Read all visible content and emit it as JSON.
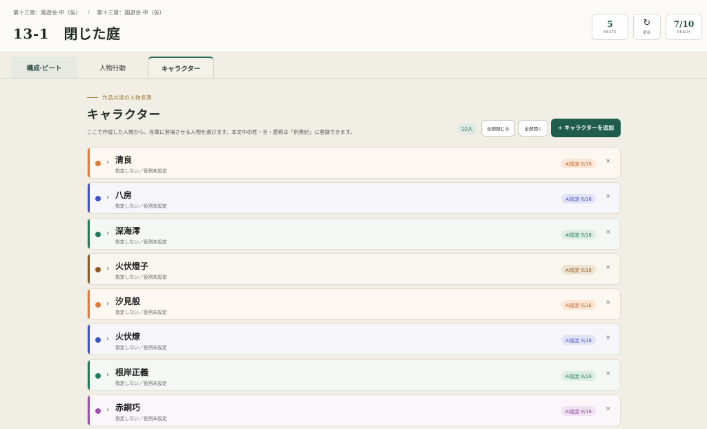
{
  "header": {
    "breadcrumb": [
      "第十三章：園遊会·中（仮）",
      "/",
      "第十三章：園遊会·中（仮）"
    ],
    "title_number": "13-1",
    "title_text": "閉じた庭",
    "stats": {
      "beats_value": "5",
      "beats_label": "BEATS",
      "update_icon": "↻",
      "update_label": "更新",
      "ready_value": "7/10",
      "ready_label": "READY"
    }
  },
  "tabs": [
    {
      "label": "構成·ビート"
    },
    {
      "label": "人物行動"
    },
    {
      "label": "キャラクター"
    }
  ],
  "section": {
    "eyebrow": "作品共通の人物名簿",
    "title": "キャラクター",
    "description": "ここで作成した人物から、各章に登場させる人物を選びます。本文中の姓・名・愛称は「別表記」に登録できます。",
    "count": "10人",
    "collapse_all": "全部閉じる",
    "expand_all": "全部開く",
    "add_label": "+ キャラクターを追加"
  },
  "characters": [
    {
      "name": "清良",
      "sub": "指定しない／役割未設定",
      "ai": "AI設定 0/16",
      "color": "#e07b39",
      "bg": "#fdf7f1",
      "ai_bg": "#fbe6d6",
      "ai_fg": "#c35f1f"
    },
    {
      "name": "八房",
      "sub": "指定しない／役割未設定",
      "ai": "AI設定 0/16",
      "color": "#3f4fc4",
      "bg": "#f6f6fa",
      "ai_bg": "#e2e4f6",
      "ai_fg": "#3f4fc4"
    },
    {
      "name": "深海澪",
      "sub": "指定しない／役割未設定",
      "ai": "AI設定 0/16",
      "color": "#1f7a5c",
      "bg": "#f3f8f5",
      "ai_bg": "#dcede5",
      "ai_fg": "#1f7a5c"
    },
    {
      "name": "火伏燈子",
      "sub": "指定しない／役割未設定",
      "ai": "AI設定 0/16",
      "color": "#8a5a20",
      "bg": "#f9f6f0",
      "ai_bg": "#efe4d2",
      "ai_fg": "#8a5a20"
    },
    {
      "name": "汐見般",
      "sub": "指定しない／役割未設定",
      "ai": "AI設定 0/16",
      "color": "#e07b39",
      "bg": "#fdf7f1",
      "ai_bg": "#fbe6d6",
      "ai_fg": "#c35f1f"
    },
    {
      "name": "火伏燎",
      "sub": "指定しない／役割未設定",
      "ai": "AI設定 0/16",
      "color": "#3f4fc4",
      "bg": "#f6f6fa",
      "ai_bg": "#e2e4f6",
      "ai_fg": "#3f4fc4"
    },
    {
      "name": "根岸正義",
      "sub": "指定しない／役割未設定",
      "ai": "AI設定 0/16",
      "color": "#1f7a5c",
      "bg": "#f3f8f5",
      "ai_bg": "#dcede5",
      "ai_fg": "#1f7a5c"
    },
    {
      "name": "赤銅巧",
      "sub": "指定しない／役割未設定",
      "ai": "AI設定 0/16",
      "color": "#9c4fae",
      "bg": "#faf6fa",
      "ai_bg": "#efe0f2",
      "ai_fg": "#8b3e9e"
    }
  ]
}
